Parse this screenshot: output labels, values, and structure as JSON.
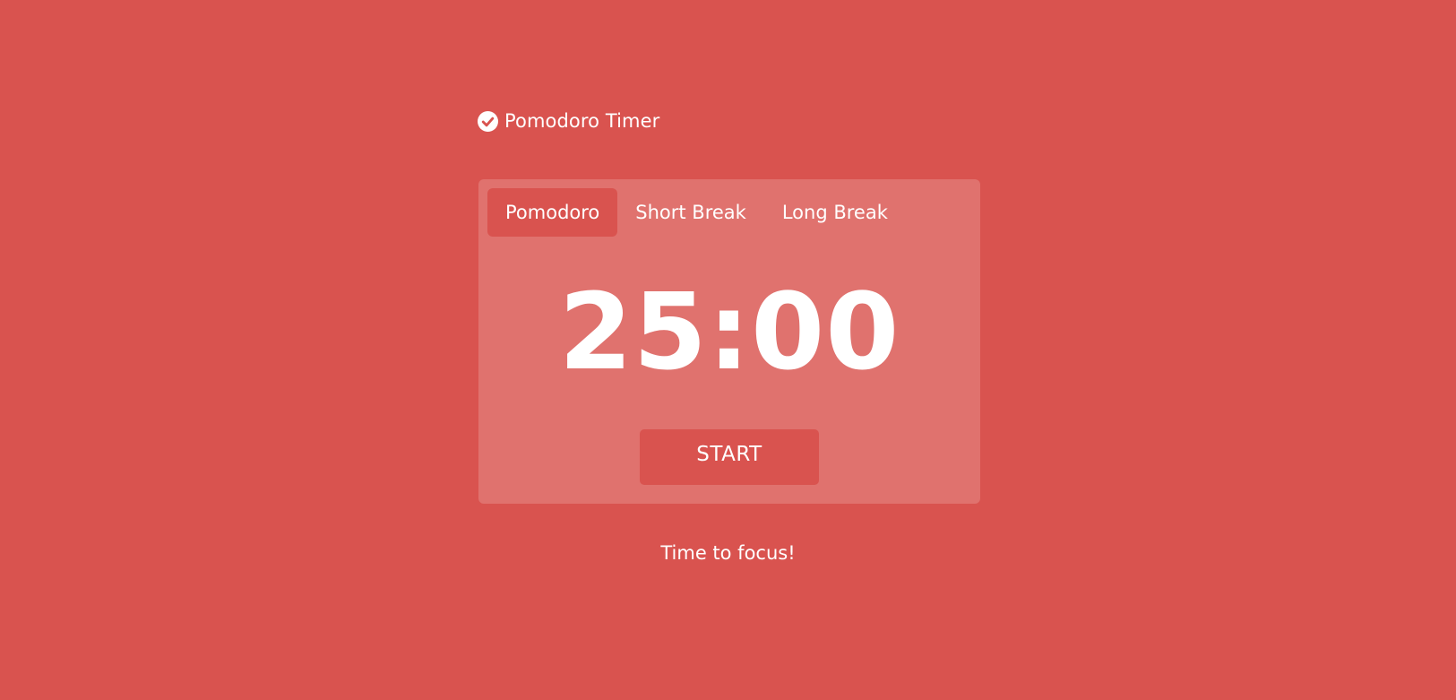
{
  "header": {
    "icon": "check-circle-icon",
    "title": "Pomodoro Timer"
  },
  "tabs": [
    {
      "label": "Pomodoro",
      "active": true
    },
    {
      "label": "Short Break",
      "active": false
    },
    {
      "label": "Long Break",
      "active": false
    }
  ],
  "timer": {
    "display": "25:00",
    "start_label": "START"
  },
  "status": {
    "message": "Time to focus!"
  },
  "colors": {
    "background": "#d9534f",
    "card": "rgba(255,255,255,0.18)",
    "text": "#ffffff"
  }
}
